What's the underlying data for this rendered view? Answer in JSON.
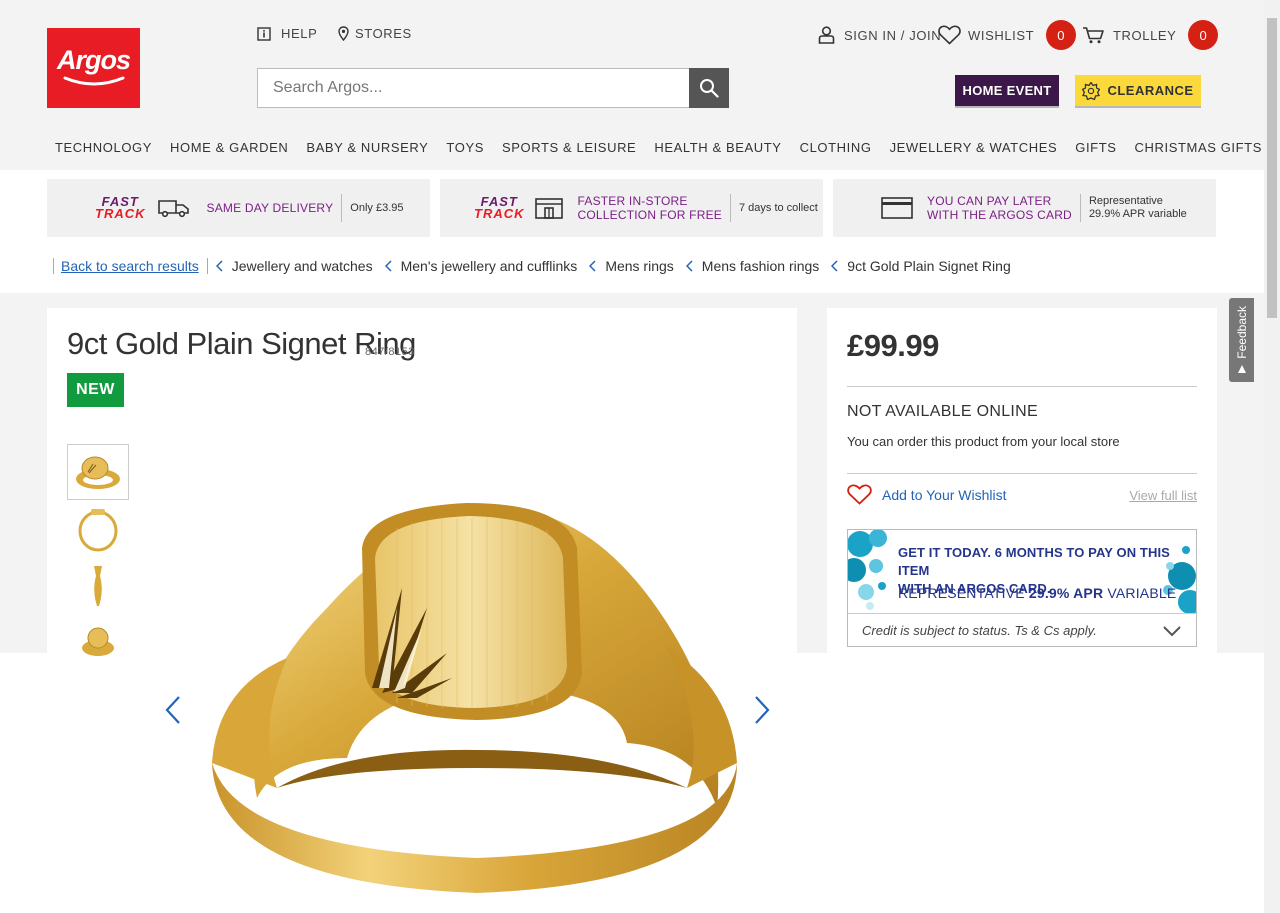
{
  "header": {
    "logo_text": "Argos",
    "help_label": "HELP",
    "stores_label": "STORES",
    "signin_label": "SIGN IN / JOIN",
    "wishlist_label": "WISHLIST",
    "wishlist_count": "0",
    "trolley_label": "TROLLEY",
    "trolley_count": "0",
    "search_placeholder": "Search Argos...",
    "home_event_label": "HOME EVENT",
    "clearance_label": "CLEARANCE"
  },
  "nav": [
    "TECHNOLOGY",
    "HOME & GARDEN",
    "BABY & NURSERY",
    "TOYS",
    "SPORTS & LEISURE",
    "HEALTH & BEAUTY",
    "CLOTHING",
    "JEWELLERY & WATCHES",
    "GIFTS",
    "CHRISTMAS GIFTS"
  ],
  "benefits": {
    "fasttrack_line1": "FAST",
    "fasttrack_line2": "TRACK",
    "delivery_title": "SAME DAY DELIVERY",
    "delivery_note": "Only £3.95",
    "collection_title_1": "FASTER IN-STORE",
    "collection_title_2": "COLLECTION FOR FREE",
    "collection_note": "7 days to collect",
    "paylater_title_1": "YOU CAN PAY LATER",
    "paylater_title_2": "WITH THE ARGOS CARD",
    "paylater_note_1": "Representative",
    "paylater_note_2": "29.9% APR variable"
  },
  "breadcrumb": {
    "back": "Back to search results",
    "items": [
      "Jewellery and watches",
      "Men's jewellery and cufflinks",
      "Mens rings",
      "Mens fashion rings",
      "9ct Gold Plain Signet Ring"
    ]
  },
  "product": {
    "title": "9ct Gold Plain Signet Ring",
    "cat_number": "847/8153",
    "badge": "NEW"
  },
  "purchase": {
    "price": "£99.99",
    "availability": "NOT AVAILABLE ONLINE",
    "availability_note": "You can order this product from your local store",
    "wishlist_add": "Add to Your Wishlist",
    "view_full_list": "View full list",
    "promo_line1": "GET IT TODAY. 6 MONTHS TO PAY ON THIS ITEM",
    "promo_line2": "WITH AN ARGOS CARD.",
    "promo_rep": "REPRESENTATIVE",
    "promo_apr": "29.9% APR",
    "promo_variable": "VARIABLE",
    "promo_terms": "Credit is subject to status. Ts & Cs apply."
  },
  "feedback_label": "Feedback",
  "colors": {
    "brand_red": "#e71c24",
    "home_event_bg": "#3c1749",
    "clearance_bg": "#fcd93b",
    "new_badge": "#119a3e",
    "link_blue": "#2364b7",
    "badge_red": "#d42114"
  }
}
